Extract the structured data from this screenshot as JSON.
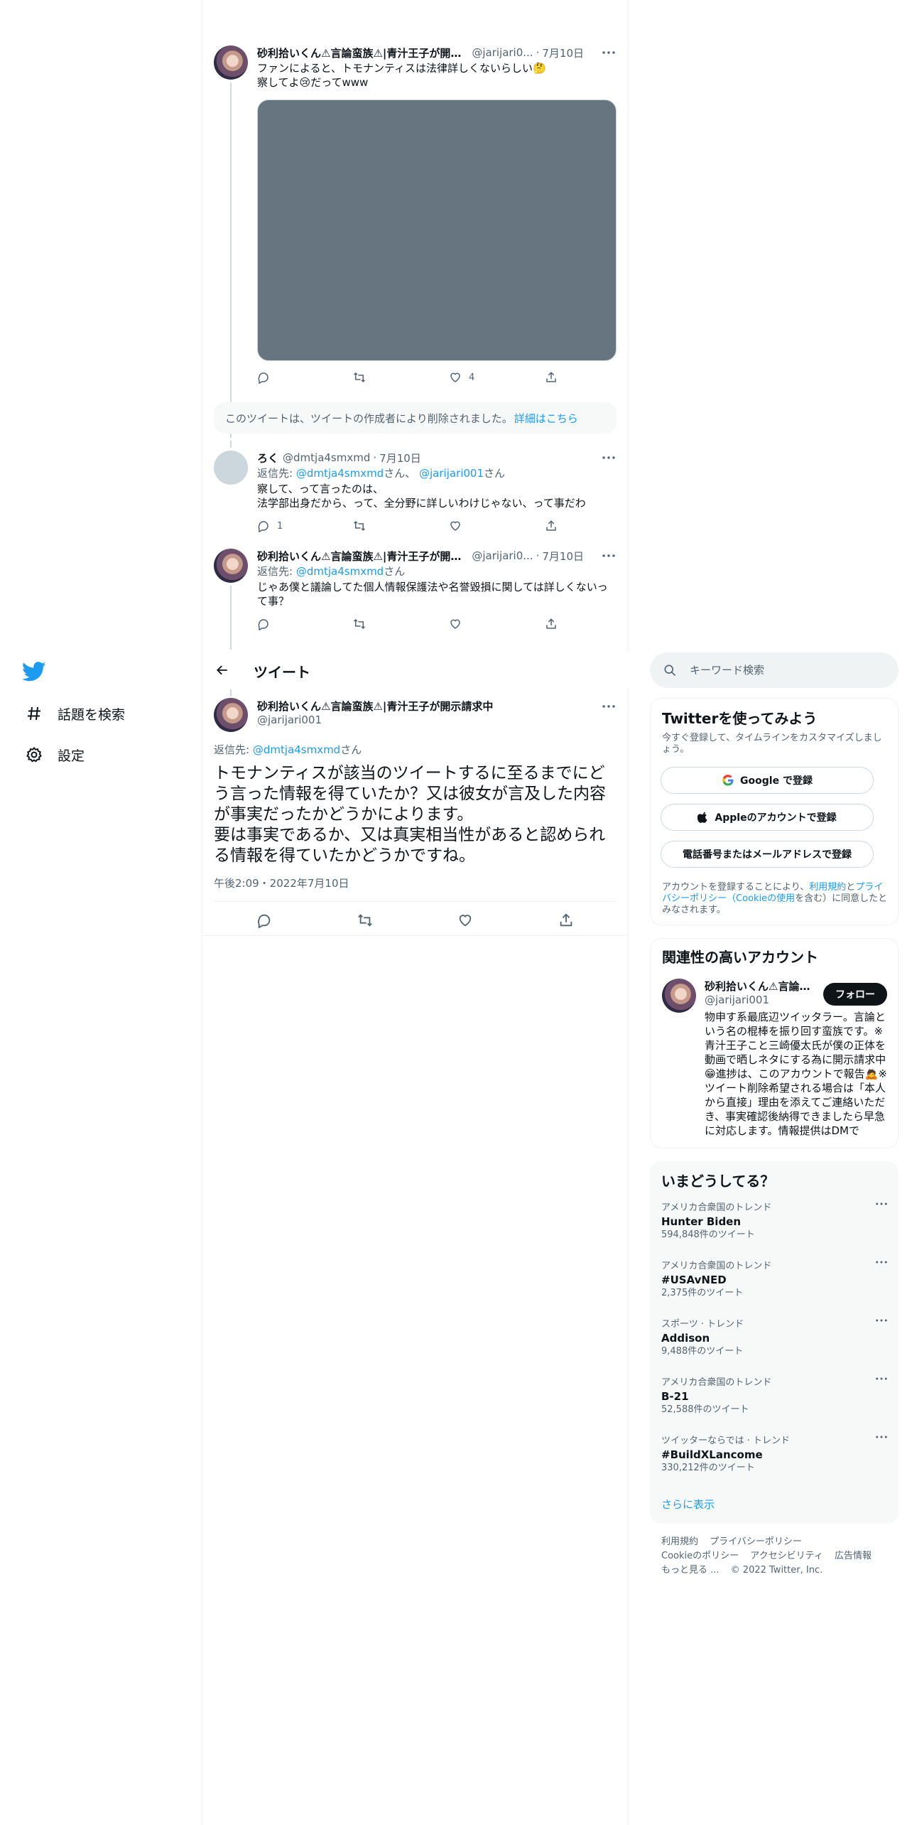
{
  "nav": {
    "explore_label": "話題を検索",
    "settings_label": "設定"
  },
  "thread": {
    "tweet1": {
      "name": "砂利拾いくん⚠言論蛮族⚠|青汁王子が開示請...",
      "handle": "@jarijari0...",
      "date": "7月10日",
      "text_line1": "ファンによると、トモナンティスは法律詳しくないらしい🤔",
      "text_line2": "察してよ😢だってwww",
      "likes": "4"
    },
    "deleted_notice": "このツイートは、ツイートの作成者により削除されました。",
    "deleted_link": "詳細はこちら",
    "tweet2": {
      "name": "ろく",
      "handle": "@dmtja4smxmd",
      "date": "7月10日",
      "reply_prefix": "返信先:",
      "reply_mention1": "@dmtja4smxmd",
      "reply_mid": "さん、",
      "reply_mention2": "@jarijari001",
      "reply_suffix": "さん",
      "text_line1": "察して、って言ったのは、",
      "text_line2": "法学部出身だから、って、全分野に詳しいわけじゃない、って事だわ",
      "replies": "1"
    },
    "tweet3": {
      "name": "砂利拾いくん⚠言論蛮族⚠|青汁王子が開示請...",
      "handle": "@jarijari0...",
      "date": "7月10日",
      "reply_prefix": "返信先:",
      "reply_mention": "@dmtja4smxmd",
      "reply_suffix": "さん",
      "text": "じゃあ僕と議論してた個人情報保護法や名誉毀損に関しては詳しくないって事？"
    }
  },
  "header": {
    "title": "ツイート"
  },
  "focus": {
    "name": "砂利拾いくん⚠言論蛮族⚠|青汁王子が開示請求中",
    "handle": "@jarijari001",
    "reply_prefix": "返信先:",
    "reply_mention": "@dmtja4smxmd",
    "reply_suffix": "さん",
    "text_p1": "トモナンティスが該当のツイートするに至るまでにどう言った情報を得ていたか？又は彼女が言及した内容が事実だったかどうかによります。",
    "text_p2": "要は事実であるか、又は真実相当性があると認められる情報を得ていたかどうかですね。",
    "time": "午後2:09・2022年7月10日"
  },
  "search": {
    "placeholder": "キーワード検索"
  },
  "signup": {
    "title": "Twitterを使ってみよう",
    "subtitle": "今すぐ登録して、タイムラインをカスタマイズしましょう。",
    "google_label": "Google で登録",
    "apple_label": "Appleのアカウントで登録",
    "phone_label": "電話番号またはメールアドレスで登録",
    "legal_1": "アカウントを登録することにより、",
    "legal_terms": "利用規約",
    "legal_and": "と",
    "legal_privacy": "プライバシーポリシー（Cookieの使用",
    "legal_2": "を含む）に同意したとみなされます。"
  },
  "related": {
    "title": "関連性の高いアカウント",
    "name": "砂利拾いくん⚠言論...",
    "handle": "@jarijari001",
    "follow_label": "フォロー",
    "bio": "物申す系最底辺ツイッタラー。言論という名の棍棒を振り回す蛮族です。※青汁王子こと三崎優太氏が僕の正体を動画で晒しネタにする為に開示請求中😁進捗は、このアカウントで報告🙇※ツイート削除希望される場合は「本人から直接」理由を添えてご連絡いただき、事実確認後納得できましたら早急に対応します。情報提供はDMで"
  },
  "trends": {
    "title": "いまどうしてる？",
    "items": [
      {
        "context": "アメリカ合衆国のトレンド",
        "name": "Hunter Biden",
        "count": "594,848件のツイート"
      },
      {
        "context": "アメリカ合衆国のトレンド",
        "name": "#USAvNED",
        "count": "2,375件のツイート"
      },
      {
        "context": "スポーツ · トレンド",
        "name": "Addison",
        "count": "9,488件のツイート"
      },
      {
        "context": "アメリカ合衆国のトレンド",
        "name": "B-21",
        "count": "52,588件のツイート"
      },
      {
        "context": "ツイッターならでは · トレンド",
        "name": "#BuildXLancome",
        "count": "330,212件のツイート"
      }
    ],
    "show_more": "さらに表示"
  },
  "footer": {
    "terms": "利用規約",
    "privacy": "プライバシーポリシー",
    "cookie": "Cookieのポリシー",
    "accessibility": "アクセシビリティ",
    "ads": "広告情報",
    "more": "もっと見る ...",
    "copyright": "© 2022 Twitter, Inc."
  },
  "colors": {
    "accent": "#1d9bf0",
    "text": "#0f1419",
    "secondary": "#536471",
    "media": "#66757f"
  }
}
